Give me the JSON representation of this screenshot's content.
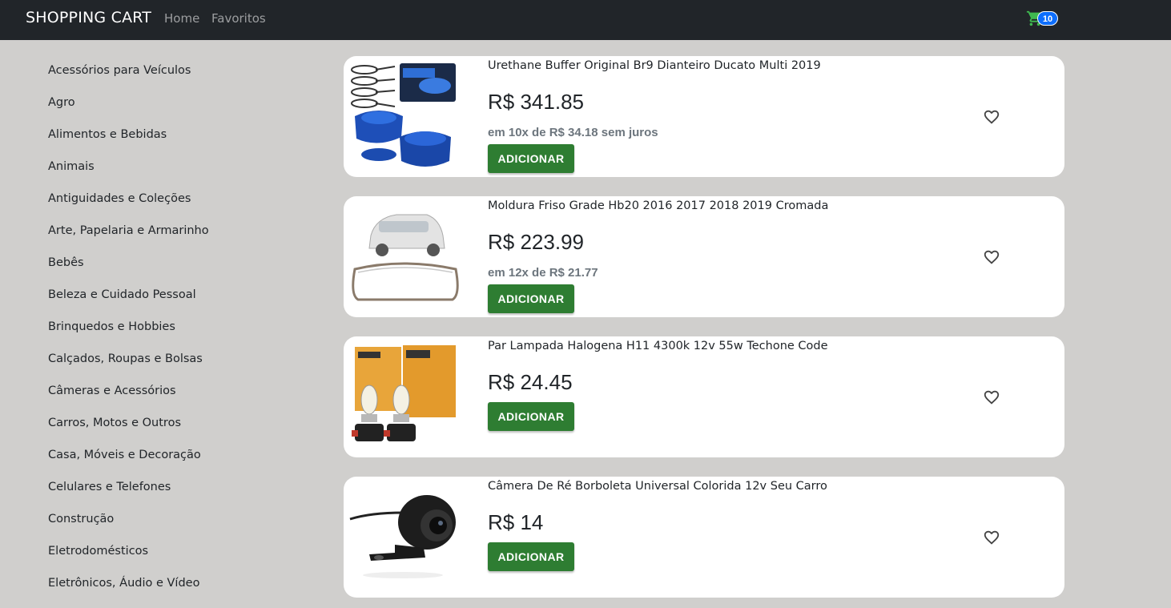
{
  "navbar": {
    "brand": "SHOPPING CART",
    "links": [
      "Home",
      "Favoritos"
    ],
    "cart_count": "10",
    "accent_color": "#0d6efd",
    "cart_icon_color": "#3fb950"
  },
  "sidebar": {
    "categories": [
      "Acessórios para Veículos",
      "Agro",
      "Alimentos e Bebidas",
      "Animais",
      "Antiguidades e Coleções",
      "Arte, Papelaria e Armarinho",
      "Bebês",
      "Beleza e Cuidado Pessoal",
      "Brinquedos e Hobbies",
      "Calçados, Roupas e Bolsas",
      "Câmeras e Acessórios",
      "Carros, Motos e Outros",
      "Casa, Móveis e Decoração",
      "Celulares e Telefones",
      "Construção",
      "Eletrodomésticos",
      "Eletrônicos, Áudio e Vídeo"
    ]
  },
  "products": [
    {
      "title": "Urethane Buffer Original Br9 Dianteiro Ducato Multi 2019",
      "price": "R$ 341.85",
      "installments": "em 10x de R$ 34.18 sem juros",
      "button": "ADICIONAR",
      "image_icon": "blue-buffer-kit-image"
    },
    {
      "title": "Moldura Friso Grade Hb20 2016 2017 2018 2019 Cromada",
      "price": "R$ 223.99",
      "installments": "em 12x de R$ 21.77",
      "button": "ADICIONAR",
      "image_icon": "car-grille-trim-image"
    },
    {
      "title": "Par Lampada Halogena H11 4300k 12v 55w Techone Code",
      "price": "R$ 24.45",
      "button": "ADICIONAR",
      "image_icon": "halogen-bulbs-image"
    },
    {
      "title": "Câmera De Ré Borboleta Universal Colorida 12v Seu Carro",
      "price": "R$ 14",
      "button": "ADICIONAR",
      "image_icon": "reverse-camera-image"
    }
  ],
  "colors": {
    "button_green": "#2e7d32",
    "background": "#d0cfcd",
    "navbar": "#212529"
  }
}
